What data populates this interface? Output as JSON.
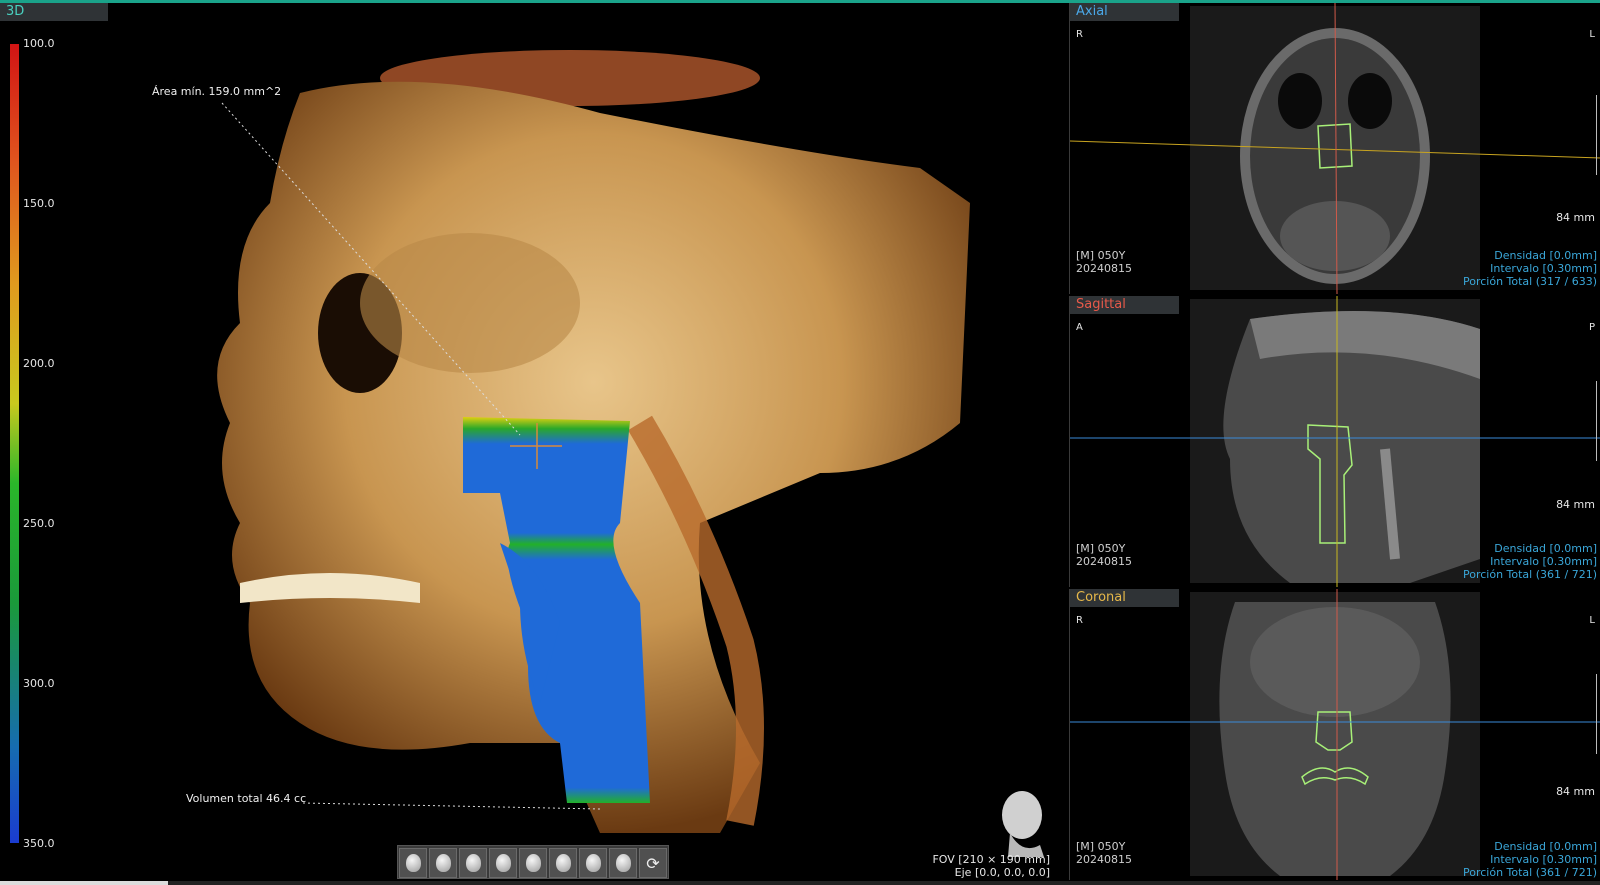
{
  "panel3d": {
    "tab_label": "3D",
    "scale_labels": [
      "100.0",
      "150.0",
      "200.0",
      "250.0",
      "300.0",
      "350.0"
    ],
    "min_area_label": "Área mín. 159.0 mm^2",
    "total_volume_label": "Volumen total 46.4 cc",
    "fov_label": "FOV [210 × 190 mm]",
    "axis_label": "Eje [0.0, 0.0, 0.0]",
    "toolbar_icons": [
      "head-front-view-icon",
      "head-left-view-icon",
      "head-right-view-icon",
      "head-3q-left-icon",
      "head-3q-right-icon",
      "head-top-view-icon",
      "head-bottom-view-icon",
      "head-back-view-icon",
      "rotate-view-icon"
    ]
  },
  "axial": {
    "title": "Axial",
    "orient_left": "R",
    "orient_right": "L",
    "scale": "84 mm",
    "patient": "[M] 050Y",
    "date": "20240815",
    "density": "Densidad [0.0mm]",
    "interval": "Intervalo [0.30mm]",
    "slice": "Porción Total (317 / 633)",
    "title_color": "#4aa8e8"
  },
  "sagittal": {
    "title": "Sagittal",
    "orient_left": "A",
    "orient_right": "P",
    "scale": "84 mm",
    "patient": "[M] 050Y",
    "date": "20240815",
    "density": "Densidad [0.0mm]",
    "interval": "Intervalo [0.30mm]",
    "slice": "Porción Total (361 / 721)",
    "title_color": "#e85a4a"
  },
  "coronal": {
    "title": "Coronal",
    "orient_left": "R",
    "orient_right": "L",
    "scale": "84 mm",
    "patient": "[M] 050Y",
    "date": "20240815",
    "density": "Densidad [0.0mm]",
    "interval": "Intervalo [0.30mm]",
    "slice": "Porción Total (361 / 721)",
    "title_color": "#e6b84a"
  }
}
